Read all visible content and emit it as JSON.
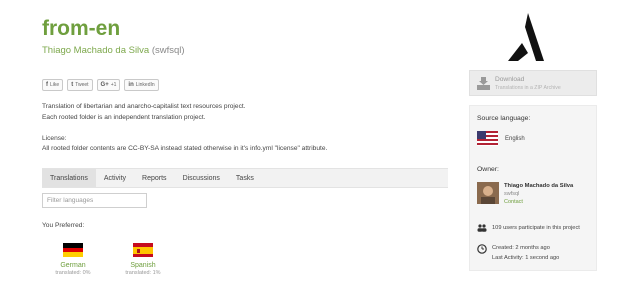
{
  "project": {
    "title": "from-en",
    "owner_name": "Thiago Machado da Silva",
    "owner_nick": "(swfsql)"
  },
  "share_buttons": [
    {
      "label": "Like",
      "glyph": "f"
    },
    {
      "label": "Tweet",
      "glyph": "t"
    },
    {
      "label": "+1",
      "glyph": "G+"
    },
    {
      "label": "LinkedIn",
      "glyph": "in"
    }
  ],
  "description": {
    "line1": "Translation of libertarian and anarcho-capitalist text resources project.",
    "line2": "Each rooted folder is an independent translation project."
  },
  "license": {
    "heading": "License:",
    "text": "All rooted folder contents are CC-BY-SA instead stated otherwise in it's info.yml \"license\" attribute."
  },
  "tabs": [
    "Translations",
    "Activity",
    "Reports",
    "Discussions",
    "Tasks"
  ],
  "filter": {
    "placeholder": "Filter languages"
  },
  "preferred": {
    "label": "You Preferred:",
    "languages": [
      {
        "name": "German",
        "translated": "translated: 0%"
      },
      {
        "name": "Spanish",
        "translated": "translated: 1%"
      }
    ]
  },
  "download": {
    "title": "Download",
    "subtitle": "Translations in a ZIP Archive"
  },
  "sidebar": {
    "source_label": "Source language:",
    "source_language": "English",
    "owner_label": "Owner:",
    "owner_name": "Thiago Machado da Silva",
    "owner_nick": "swfsql",
    "contact": "Contact",
    "participants": "109 users participate in this project",
    "created": "Created: 2 months ago",
    "last_activity": "Last Activity: 1 second ago"
  },
  "colors": {
    "accent": "#6f9f3e",
    "tab_bg": "#f2f2f2",
    "panel_bg": "#f5f5f5"
  },
  "icons": [
    "logo-icon",
    "download-icon",
    "us-flag-icon",
    "users-icon",
    "clock-icon",
    "german-flag-icon",
    "spanish-flag-icon"
  ]
}
